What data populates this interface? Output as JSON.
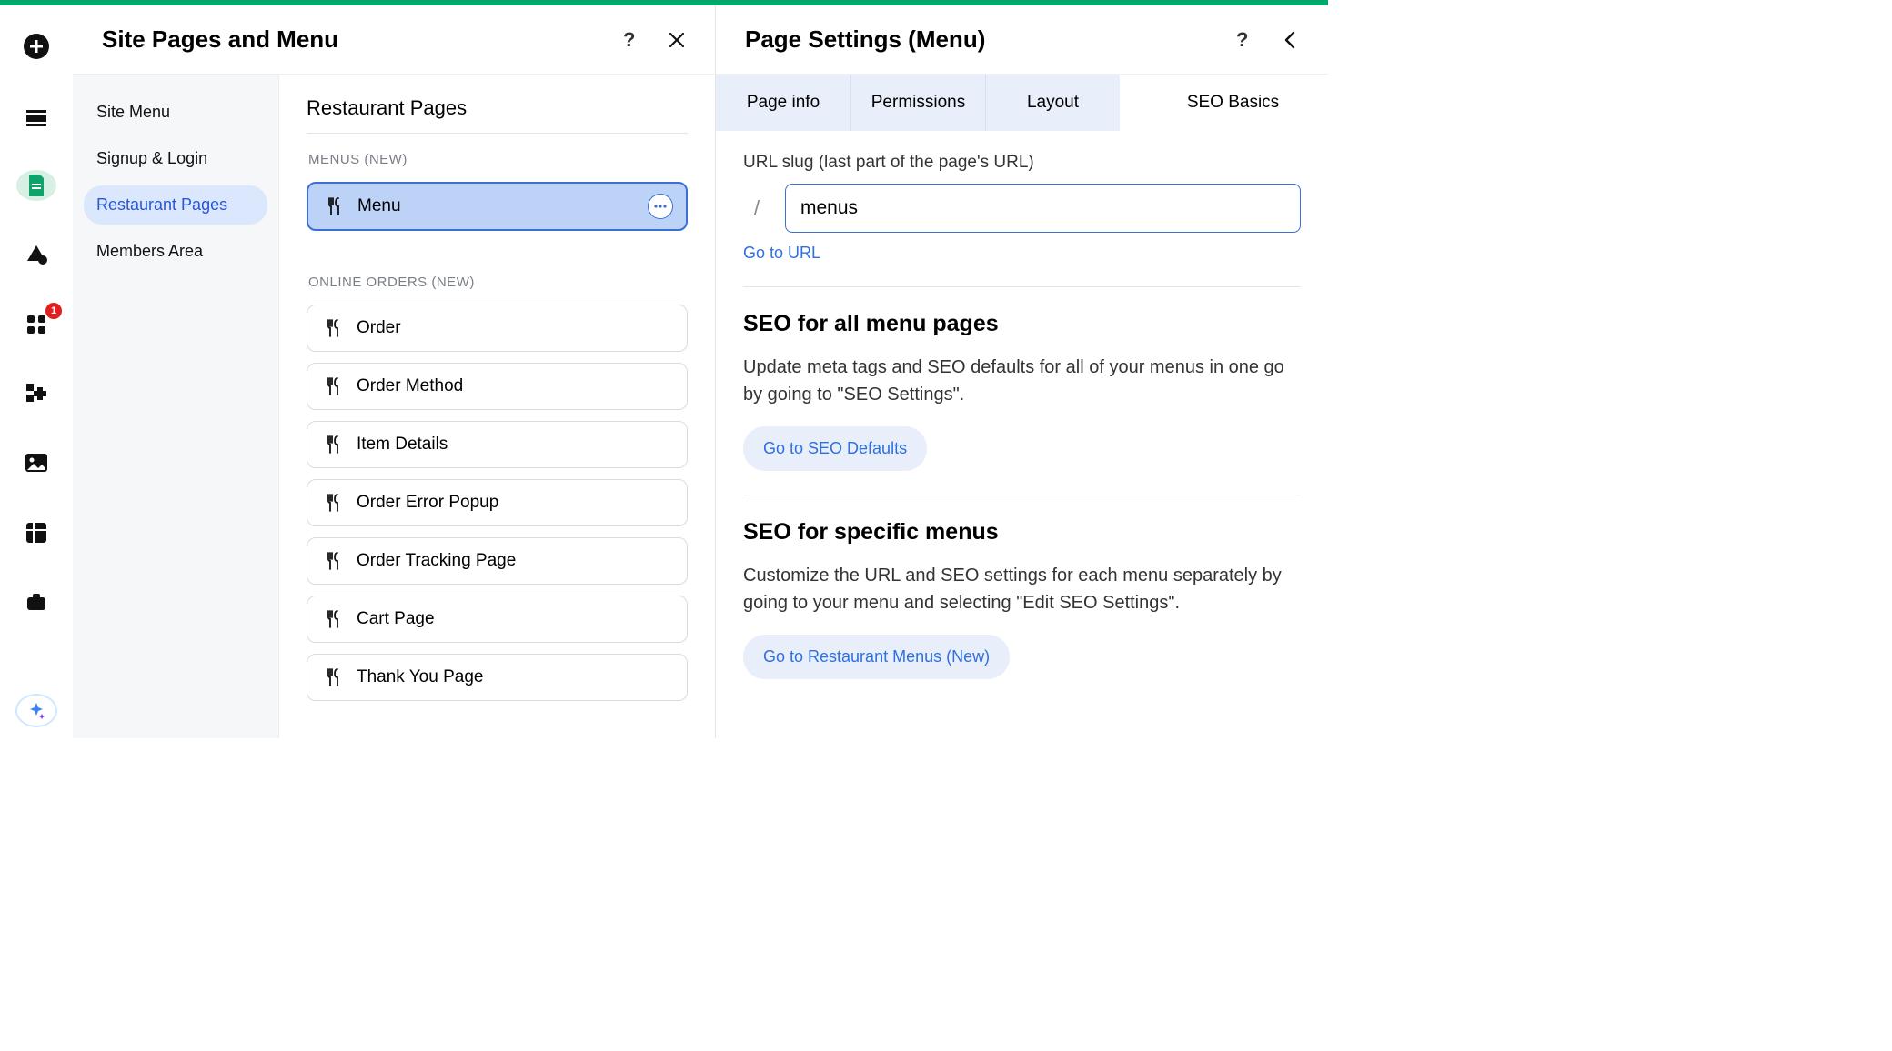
{
  "rail": {
    "badge": "1"
  },
  "leftPanel": {
    "title": "Site Pages and Menu",
    "nav": [
      "Site Menu",
      "Signup & Login",
      "Restaurant Pages",
      "Members Area"
    ],
    "navActiveIndex": 2,
    "colTitle": "Restaurant Pages",
    "group1Label": "MENUS (NEW)",
    "group1": [
      "Menu"
    ],
    "group2Label": "ONLINE ORDERS (NEW)",
    "group2": [
      "Order",
      "Order Method",
      "Item Details",
      "Order Error Popup",
      "Order Tracking Page",
      "Cart Page",
      "Thank You Page"
    ]
  },
  "rightPanel": {
    "title": "Page Settings (Menu)",
    "tabs": [
      "Page info",
      "Permissions",
      "Layout",
      "SEO Basics"
    ],
    "activeTabIndex": 3,
    "slugLabel": "URL slug (last part of the page's URL)",
    "slash": "/",
    "slugValue": "menus",
    "goToUrl": "Go to URL",
    "section1": {
      "heading": "SEO for all menu pages",
      "body": "Update meta tags and SEO defaults for all of your menus in one go by going to \"SEO Settings\".",
      "button": "Go to SEO Defaults"
    },
    "section2": {
      "heading": "SEO for specific menus",
      "body": "Customize the URL and SEO settings for each menu separately by going to your menu and selecting \"Edit SEO Settings\".",
      "button": "Go to Restaurant Menus (New)"
    }
  }
}
